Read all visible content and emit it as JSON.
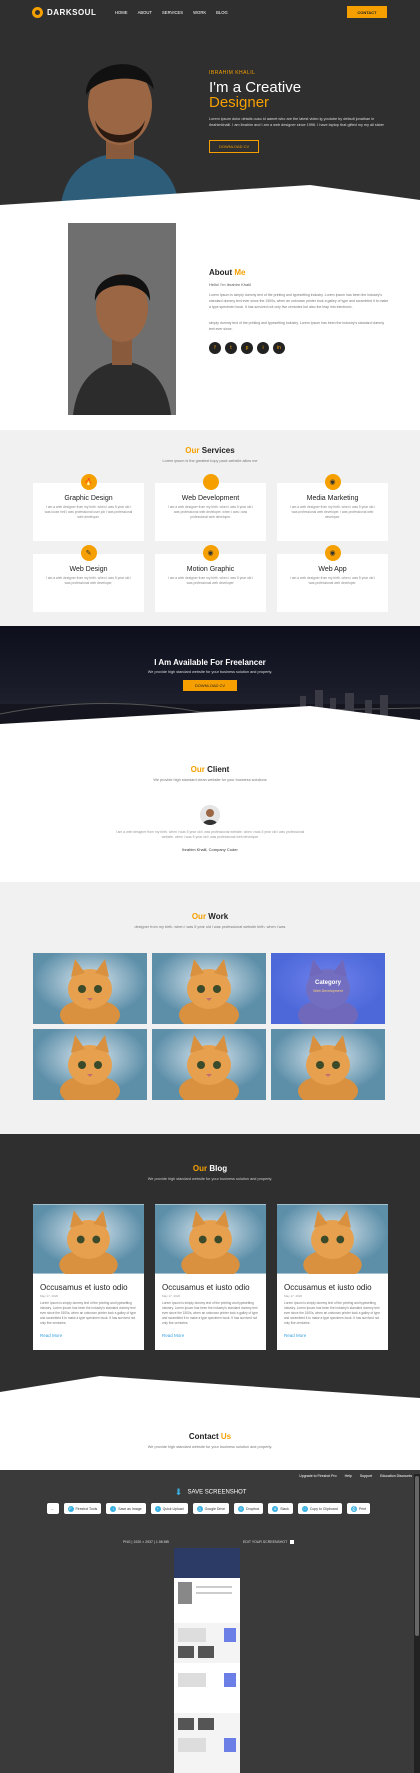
{
  "header": {
    "logo": "DARKSOUL",
    "nav": [
      "HOME",
      "ABOUT",
      "SERVICES",
      "WORK",
      "BLOG"
    ],
    "contact_button": "CONTACT"
  },
  "hero": {
    "name": "IBRAHIM KHALIL",
    "title_line1": "I'm a Creative",
    "title_line2": "Designer",
    "description": "Lorem ipsum dolor details ouso id aamet who are the latest video ig youtube by default jonathan ie ibrahimkhalil. I am ibrahim and I am a web designer since 1996. I have laptop that gifted my my all sister",
    "download_button": "DOWNLOAD CV"
  },
  "about": {
    "heading": "About",
    "heading_accent": "Me",
    "subtitle": "Hello! I'm Ibrahim Khalil",
    "para1": "Lorem Ipsum is simply dummy text of the printing and typesetting industry. Lorem Ipsum has been the industry's standard dummy text ever since the 1500s, when an unknown printer took a galley of type and scrambled it to make a type specimen book. It has survived not only five centuries but also the leap into electronic.",
    "para2": "simply dummy text of the printing and typesetting industry. Lorem Ipsum has been the industry's standard dummy text ever since.",
    "socials": [
      "f",
      "t",
      "p",
      "i",
      "in"
    ]
  },
  "services": {
    "heading": "Services",
    "heading_accent": "Our",
    "subtitle": "Lorem ipsum is the greatest kopy pack website allow me",
    "items": [
      {
        "title": "Graphic Design",
        "desc": "I am a web designer from my birth. when i was 5 year old i was loose hell i was professional user job i was professional web developer."
      },
      {
        "title": "Web Development",
        "desc": "I am a web designer from my birth. when i was 5 year old i was professional web developer. when i was i was professional web developer."
      },
      {
        "title": "Media Marketing",
        "desc": "I am a web designer from my birth. when i was 5 year old i was professional web developer. i was professional web developer."
      },
      {
        "title": "Web Design",
        "desc": "I am a web designer from my birth. when i was 5 year old i was professional web developer."
      },
      {
        "title": "Motion Graphic",
        "desc": "I am a web designer from my birth. when i was 5 year old i was professional web developer."
      },
      {
        "title": "Web App",
        "desc": "I am a web designer from my birth. when i was 5 year old i was professional web developer."
      }
    ]
  },
  "freelance": {
    "heading": "I Am Available For Freelancer",
    "subtitle": "We provide high standard website for your business solution and property.",
    "button": "DOWNLOAD CV"
  },
  "client": {
    "heading": "Client",
    "heading_accent": "Our",
    "subtitle": "We provide high standard clean website for your business solutions",
    "quote": "I am a web designer from my birth. when i was 5 year old i was professional website. when i was 5 year old i was professional website. when i was 5 year old i was professional web developer",
    "name": "Ibrahim Khalil, Company Coder"
  },
  "work": {
    "heading": "Work",
    "heading_accent": "Our",
    "subtitle": "designer from my birth. when i was 5 year old i was professional website birth. when i was",
    "overlay_title": "Category",
    "overlay_sub": "Web Development"
  },
  "blog": {
    "heading": "Blog",
    "heading_accent": "Our",
    "subtitle": "We provide high standard website for your business solution and property.",
    "posts": [
      {
        "title": "Occusamus et iusto odio",
        "date": "May 17, 2020",
        "excerpt": "Lorem Ipsum is simply dummy text of the printing and typesetting industry. Lorem Ipsum has been the industry's standard dummy text ever since the 1500s, when an unknown printer took a galley of type and scrambled it to make a type specimen book. It has survived not only five centuries.",
        "more": "Read More"
      },
      {
        "title": "Occusamus et iusto odio",
        "date": "May 17, 2020",
        "excerpt": "Lorem Ipsum is simply dummy text of the printing and typesetting industry. Lorem Ipsum has been the industry's standard dummy text ever since the 1500s, when an unknown printer took a galley of type and scrambled it to make a type specimen book. It has survived not only five centuries.",
        "more": "Read More"
      },
      {
        "title": "Occusamus et iusto odio",
        "date": "May 17, 2020",
        "excerpt": "Lorem Ipsum is simply dummy text of the printing and typesetting industry. Lorem Ipsum has been the industry's standard dummy text ever since the 1500s, when an unknown printer took a galley of type and scrambled it to make a type specimen book. It has survived not only five centuries.",
        "more": "Read More"
      }
    ]
  },
  "contact": {
    "heading": "Contact",
    "heading_accent": "Us",
    "subtitle": "We provide high standard website for your business solution and property."
  },
  "screenshot_tool": {
    "links": [
      "Upgrade to Fireshot Pro",
      "Help",
      "Support",
      "Education Discounts"
    ],
    "title": "SAVE SCREENSHOT",
    "buttons": [
      "Fireshot Tools",
      "Save as Image",
      "Quick Upload",
      "Google Drive",
      "Dropbox",
      "Slack",
      "Copy to Clipboard",
      "Print"
    ],
    "info": "PNG | 1920 × 2937 | 1.98 MB",
    "edit_label": "EDIT YOUR SCREENSHOT"
  },
  "colors": {
    "accent": "#f5a000",
    "dark": "#2f2f2f",
    "link": "#3aa0e0"
  }
}
